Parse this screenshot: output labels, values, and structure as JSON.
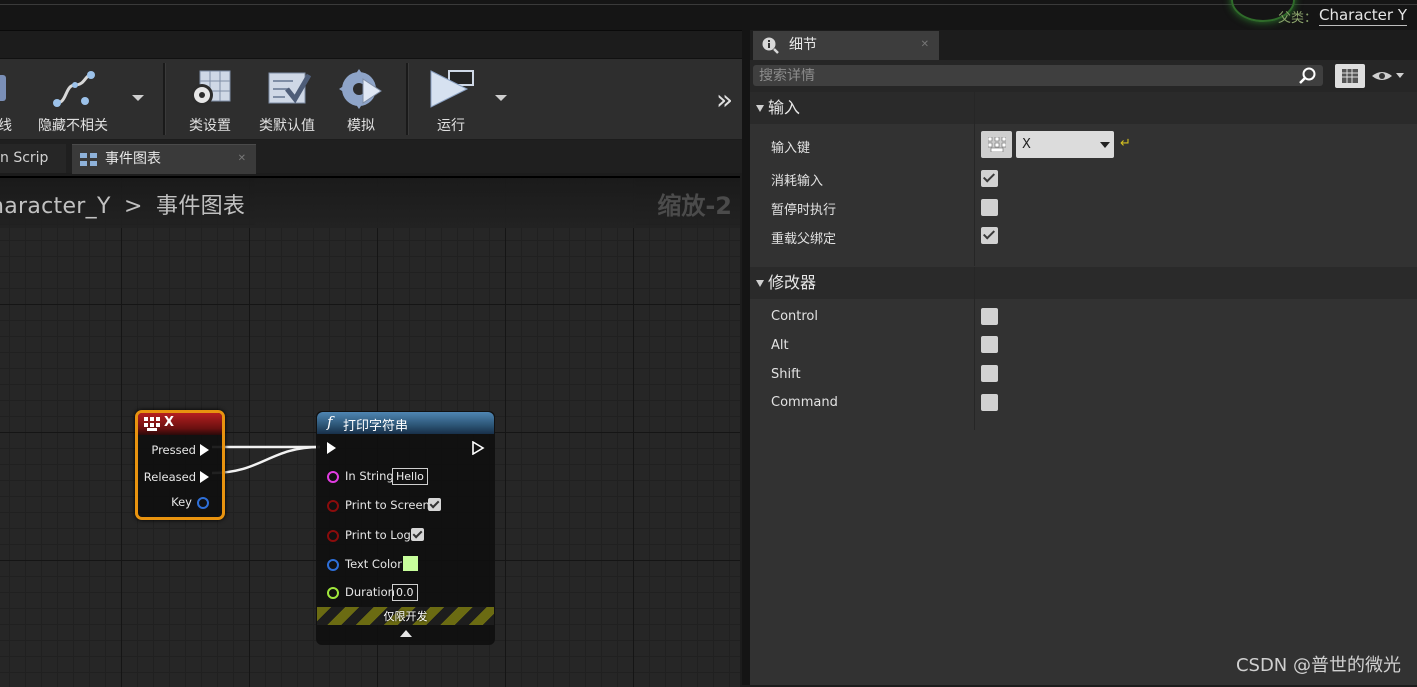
{
  "topbar": {
    "parent_label": "父类：",
    "parent_value": "Character Y"
  },
  "toolbar": {
    "partial_label": "线",
    "hide_unrelated": "隐藏不相关",
    "class_settings": "类设置",
    "class_defaults": "类默认值",
    "simulate": "模拟",
    "run": "运行"
  },
  "tabs": [
    {
      "label": "n Scrip"
    },
    {
      "label": "事件图表"
    }
  ],
  "graph": {
    "breadcrumb_root": "haracter_Y",
    "breadcrumb_sep": ">",
    "breadcrumb_current": "事件图表",
    "zoom": "缩放-2"
  },
  "node_key": {
    "title": "X",
    "pins": {
      "pressed": "Pressed",
      "released": "Released",
      "key": "Key"
    }
  },
  "node_print": {
    "title": "打印字符串",
    "in_string_label": "In String",
    "in_string_value": "Hello",
    "print_to_screen": "Print to Screen",
    "print_to_log": "Print to Log",
    "text_color": "Text Color",
    "duration_label": "Duration",
    "duration_value": "0.0",
    "dev_only": "仅限开发",
    "colors": {
      "text_color_swatch": "#c8ff9c"
    }
  },
  "details": {
    "tab_label": "细节",
    "search_placeholder": "搜索详情",
    "input_category": "输入",
    "input_key_label": "输入键",
    "input_key_value": "X",
    "consume_input": "消耗输入",
    "execute_when_paused": "暂停时执行",
    "override_parent": "重载父绑定",
    "modifiers_category": "修改器",
    "mod_control": "Control",
    "mod_alt": "Alt",
    "mod_shift": "Shift",
    "mod_command": "Command"
  },
  "watermark": "CSDN @普世的微光"
}
